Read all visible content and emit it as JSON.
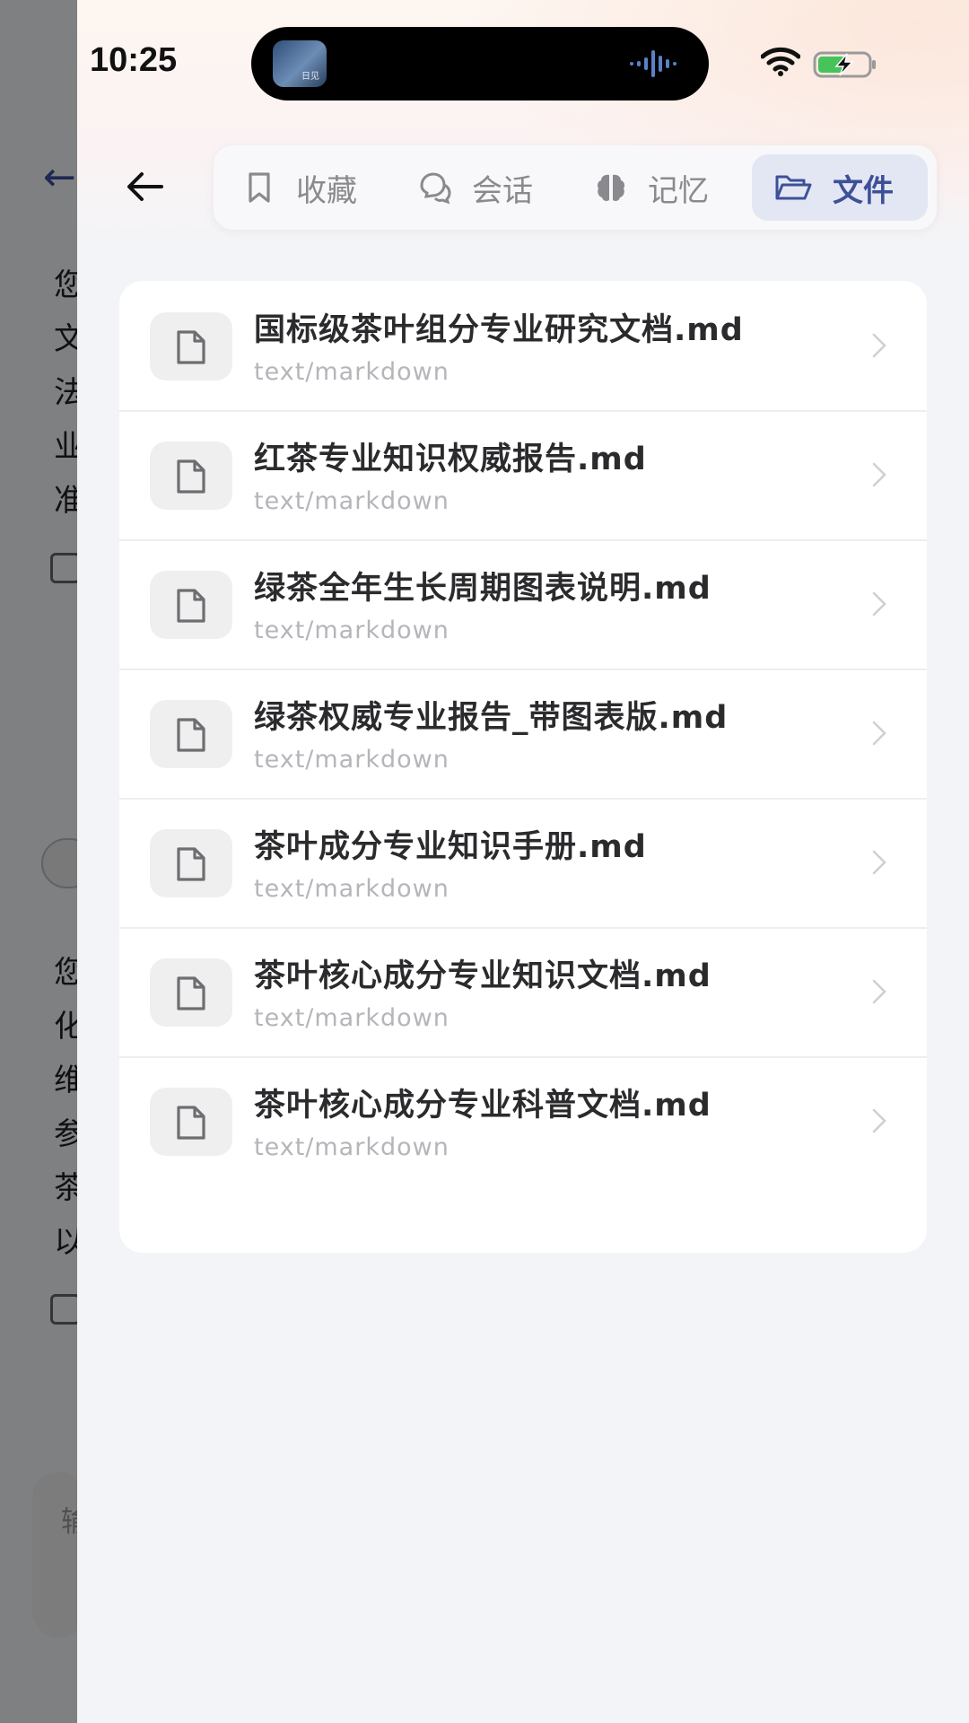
{
  "status_bar": {
    "time": "10:25",
    "island_thumbnail_label": "日见"
  },
  "background_page": {
    "lines_left": [
      "您",
      "文",
      "法",
      "业",
      "准"
    ],
    "lines_left_2": [
      "您",
      "化",
      "维",
      "参",
      "茶",
      "以"
    ],
    "input_placeholder": "输"
  },
  "tabs": [
    {
      "label": "收藏",
      "icon": "bookmark-icon",
      "active": false
    },
    {
      "label": "会话",
      "icon": "chat-bubbles-icon",
      "active": false
    },
    {
      "label": "记忆",
      "icon": "brain-icon",
      "active": false
    },
    {
      "label": "文件",
      "icon": "folder-open-icon",
      "active": true
    }
  ],
  "files": [
    {
      "name": "国标级茶叶组分专业研究文档.md",
      "type": "text/markdown"
    },
    {
      "name": "红茶专业知识权威报告.md",
      "type": "text/markdown"
    },
    {
      "name": "绿茶全年生长周期图表说明.md",
      "type": "text/markdown"
    },
    {
      "name": "绿茶权威专业报告_带图表版.md",
      "type": "text/markdown"
    },
    {
      "name": "茶叶成分专业知识手册.md",
      "type": "text/markdown"
    },
    {
      "name": "茶叶核心成分专业知识文档.md",
      "type": "text/markdown"
    },
    {
      "name": "茶叶核心成分专业科普文档.md",
      "type": "text/markdown"
    }
  ],
  "colors": {
    "accent": "#3d5099",
    "active_tab_bg": "#e3e7f3",
    "text_primary": "#2b2b2e",
    "text_secondary": "#b5b5ba"
  }
}
